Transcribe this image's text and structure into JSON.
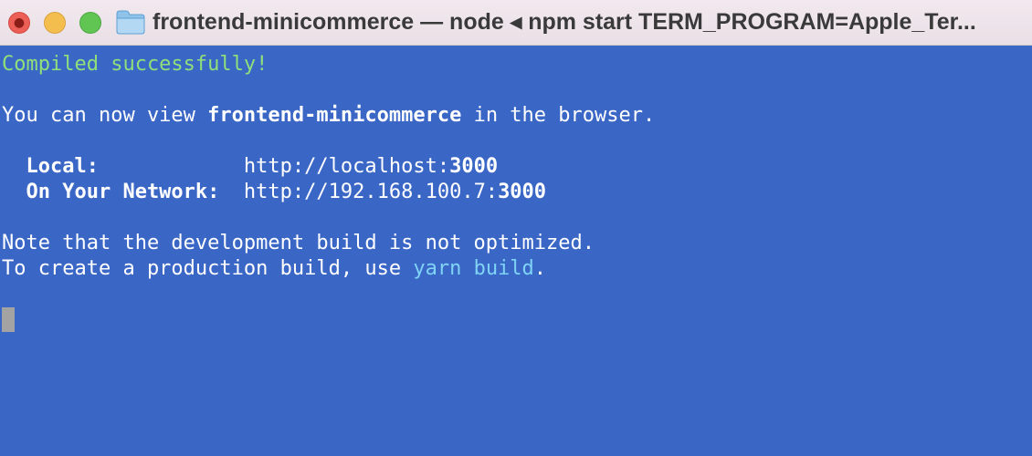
{
  "window": {
    "title": "frontend-minicommerce — node ◂ npm start TERM_PROGRAM=Apple_Ter..."
  },
  "colors": {
    "terminal_background": "#3a66c6",
    "success_text": "#8fe07a",
    "command_text": "#7fd3f5"
  },
  "terminal": {
    "compiled": "Compiled successfully!",
    "view_prefix": "You can now view ",
    "app_name": "frontend-minicommerce",
    "view_suffix": " in the browser.",
    "local_label": "  Local:            ",
    "local_url_prefix": "http://localhost:",
    "local_port": "3000",
    "network_label": "  On Your Network:  ",
    "network_url_prefix": "http://192.168.100.7:",
    "network_port": "3000",
    "note": "Note that the development build is not optimized.",
    "create_prefix": "To create a production build, use ",
    "yarn_command": "yarn build",
    "create_suffix": "."
  }
}
